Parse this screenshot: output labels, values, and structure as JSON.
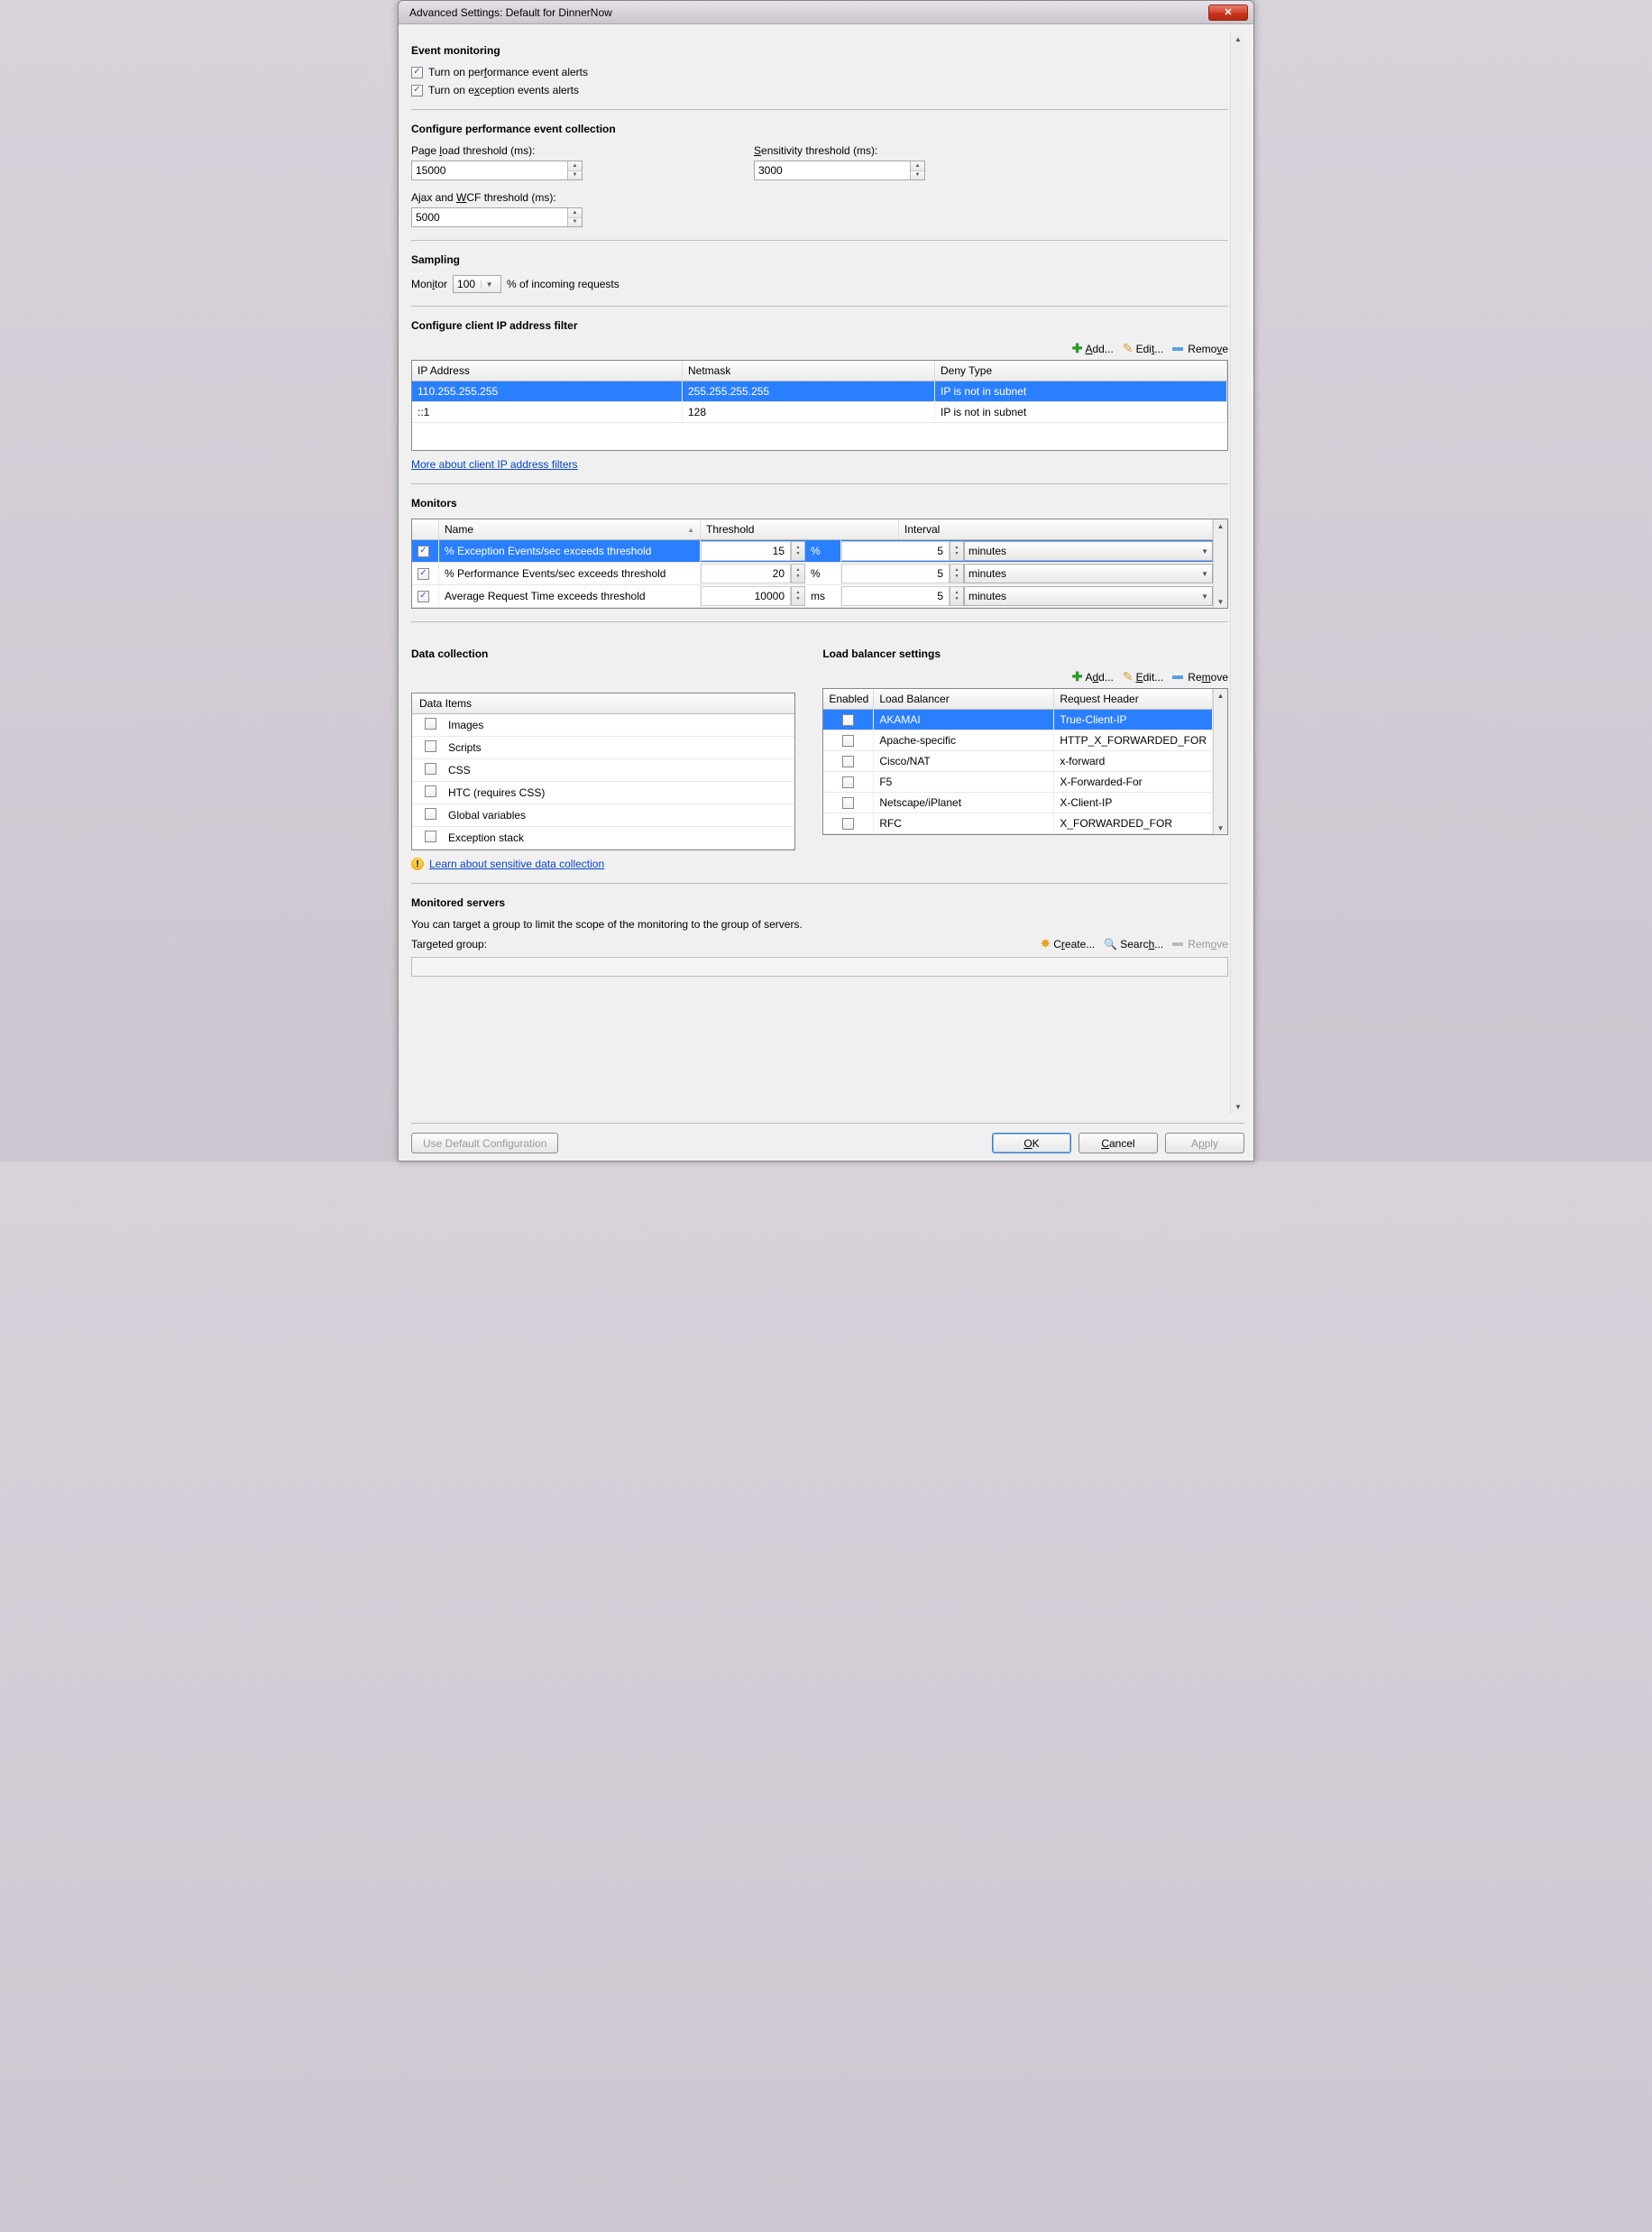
{
  "window": {
    "title": "Advanced Settings: Default for DinnerNow"
  },
  "sections": {
    "event_monitoring": {
      "title": "Event monitoring",
      "perf_alerts": "Turn on performance event alerts",
      "exception_alerts": "Turn on exception events alerts"
    },
    "perf_collection": {
      "title": "Configure performance event collection",
      "page_load_label": "Page load threshold (ms):",
      "page_load_value": "15000",
      "sensitivity_label": "Sensitivity threshold (ms):",
      "sensitivity_value": "3000",
      "ajax_label": "Ajax and WCF threshold (ms):",
      "ajax_value": "5000"
    },
    "sampling": {
      "title": "Sampling",
      "monitor_label": "Monitor",
      "monitor_value": "100",
      "suffix": "% of incoming requests"
    },
    "ip_filter": {
      "title": "Configure client IP address filter",
      "add": "Add...",
      "edit": "Edit...",
      "remove": "Remove",
      "col_ip": "IP Address",
      "col_mask": "Netmask",
      "col_deny": "Deny Type",
      "rows": [
        {
          "ip": "110.255.255.255",
          "mask": "255.255.255.255",
          "deny": "IP is not in subnet",
          "selected": true
        },
        {
          "ip": "::1",
          "mask": "128",
          "deny": "IP is not in subnet",
          "selected": false
        }
      ],
      "more_link": "More about client IP address filters"
    },
    "monitors": {
      "title": "Monitors",
      "col_name": "Name",
      "col_threshold": "Threshold",
      "col_interval": "Interval",
      "rows": [
        {
          "checked": true,
          "name": "% Exception Events/sec exceeds threshold",
          "threshold": "15",
          "unit": "%",
          "interval": "5",
          "interval_unit": "minutes",
          "selected": true
        },
        {
          "checked": true,
          "name": "% Performance Events/sec exceeds threshold",
          "threshold": "20",
          "unit": "%",
          "interval": "5",
          "interval_unit": "minutes",
          "selected": false
        },
        {
          "checked": true,
          "name": "Average Request Time exceeds threshold",
          "threshold": "10000",
          "unit": "ms",
          "interval": "5",
          "interval_unit": "minutes",
          "selected": false
        }
      ]
    },
    "data_collection": {
      "title": "Data collection",
      "header": "Data Items",
      "items": [
        {
          "label": "Images",
          "checked": false
        },
        {
          "label": "Scripts",
          "checked": false
        },
        {
          "label": "CSS",
          "checked": false
        },
        {
          "label": "HTC (requires CSS)",
          "checked": false
        },
        {
          "label": "Global variables",
          "checked": false
        },
        {
          "label": "Exception stack",
          "checked": false
        }
      ],
      "learn_link": "Learn about sensitive data collection"
    },
    "load_balancer": {
      "title": "Load balancer settings",
      "add": "Add...",
      "edit": "Edit...",
      "remove": "Remove",
      "col_enabled": "Enabled",
      "col_name": "Load Balancer",
      "col_header": "Request Header",
      "rows": [
        {
          "enabled": false,
          "name": "AKAMAI",
          "header": "True-Client-IP",
          "selected": true
        },
        {
          "enabled": false,
          "name": "Apache-specific",
          "header": "HTTP_X_FORWARDED_FOR",
          "selected": false
        },
        {
          "enabled": false,
          "name": "Cisco/NAT",
          "header": "x-forward",
          "selected": false
        },
        {
          "enabled": false,
          "name": "F5",
          "header": "X-Forwarded-For",
          "selected": false
        },
        {
          "enabled": false,
          "name": "Netscape/iPlanet",
          "header": "X-Client-IP",
          "selected": false
        },
        {
          "enabled": false,
          "name": "RFC",
          "header": "X_FORWARDED_FOR",
          "selected": false
        }
      ]
    },
    "monitored_servers": {
      "title": "Monitored servers",
      "desc": "You can target a group to limit the scope of the monitoring to the group of servers.",
      "targeted_label": "Targeted group:",
      "create": "Create...",
      "search": "Search...",
      "remove": "Remove"
    }
  },
  "footer": {
    "use_default": "Use Default Configuration",
    "ok": "OK",
    "cancel": "Cancel",
    "apply": "Apply"
  }
}
